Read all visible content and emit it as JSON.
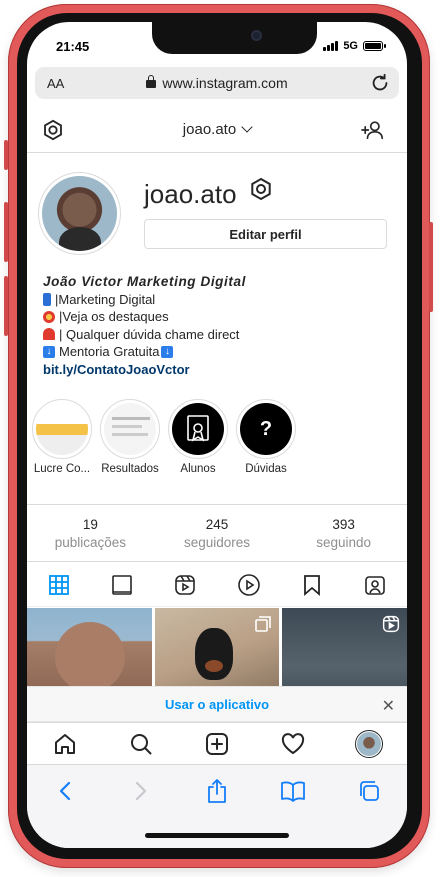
{
  "status_bar": {
    "time": "21:45",
    "network": "5G"
  },
  "browser": {
    "text_size_label": "AA",
    "host": "www.instagram.com"
  },
  "header": {
    "username": "joao.ato"
  },
  "profile": {
    "username": "joao.ato",
    "edit_label": "Editar perfil",
    "full_name": "João Victor Marketing Digital",
    "bio_lines": [
      "|Marketing Digital",
      "|Veja os destaques",
      "| Qualquer dúvida chame direct",
      " Mentoria Gratuita "
    ],
    "link": "bit.ly/ContatoJoaoVctor"
  },
  "highlights": [
    {
      "label": "Lucre Co..."
    },
    {
      "label": "Resultados"
    },
    {
      "label": "Alunos"
    },
    {
      "label": "Dúvidas"
    }
  ],
  "stats": [
    {
      "value": "19",
      "label": "publicações"
    },
    {
      "value": "245",
      "label": "seguidores"
    },
    {
      "value": "393",
      "label": "seguindo"
    }
  ],
  "app_banner": {
    "label": "Usar o aplicativo"
  },
  "colors": {
    "frame": "#e25959",
    "link": "#00376b",
    "accent": "#0095f6",
    "safari_blue": "#147efb"
  },
  "icons": {
    "tabs": [
      "grid-icon",
      "feed-icon",
      "reels-icon",
      "igtv-icon",
      "saved-icon",
      "tagged-icon"
    ],
    "nav": [
      "home-icon",
      "search-icon",
      "new-post-icon",
      "activity-icon",
      "profile-avatar"
    ],
    "safari": [
      "back-icon",
      "forward-icon",
      "share-icon",
      "bookmarks-icon",
      "tabs-icon"
    ]
  }
}
